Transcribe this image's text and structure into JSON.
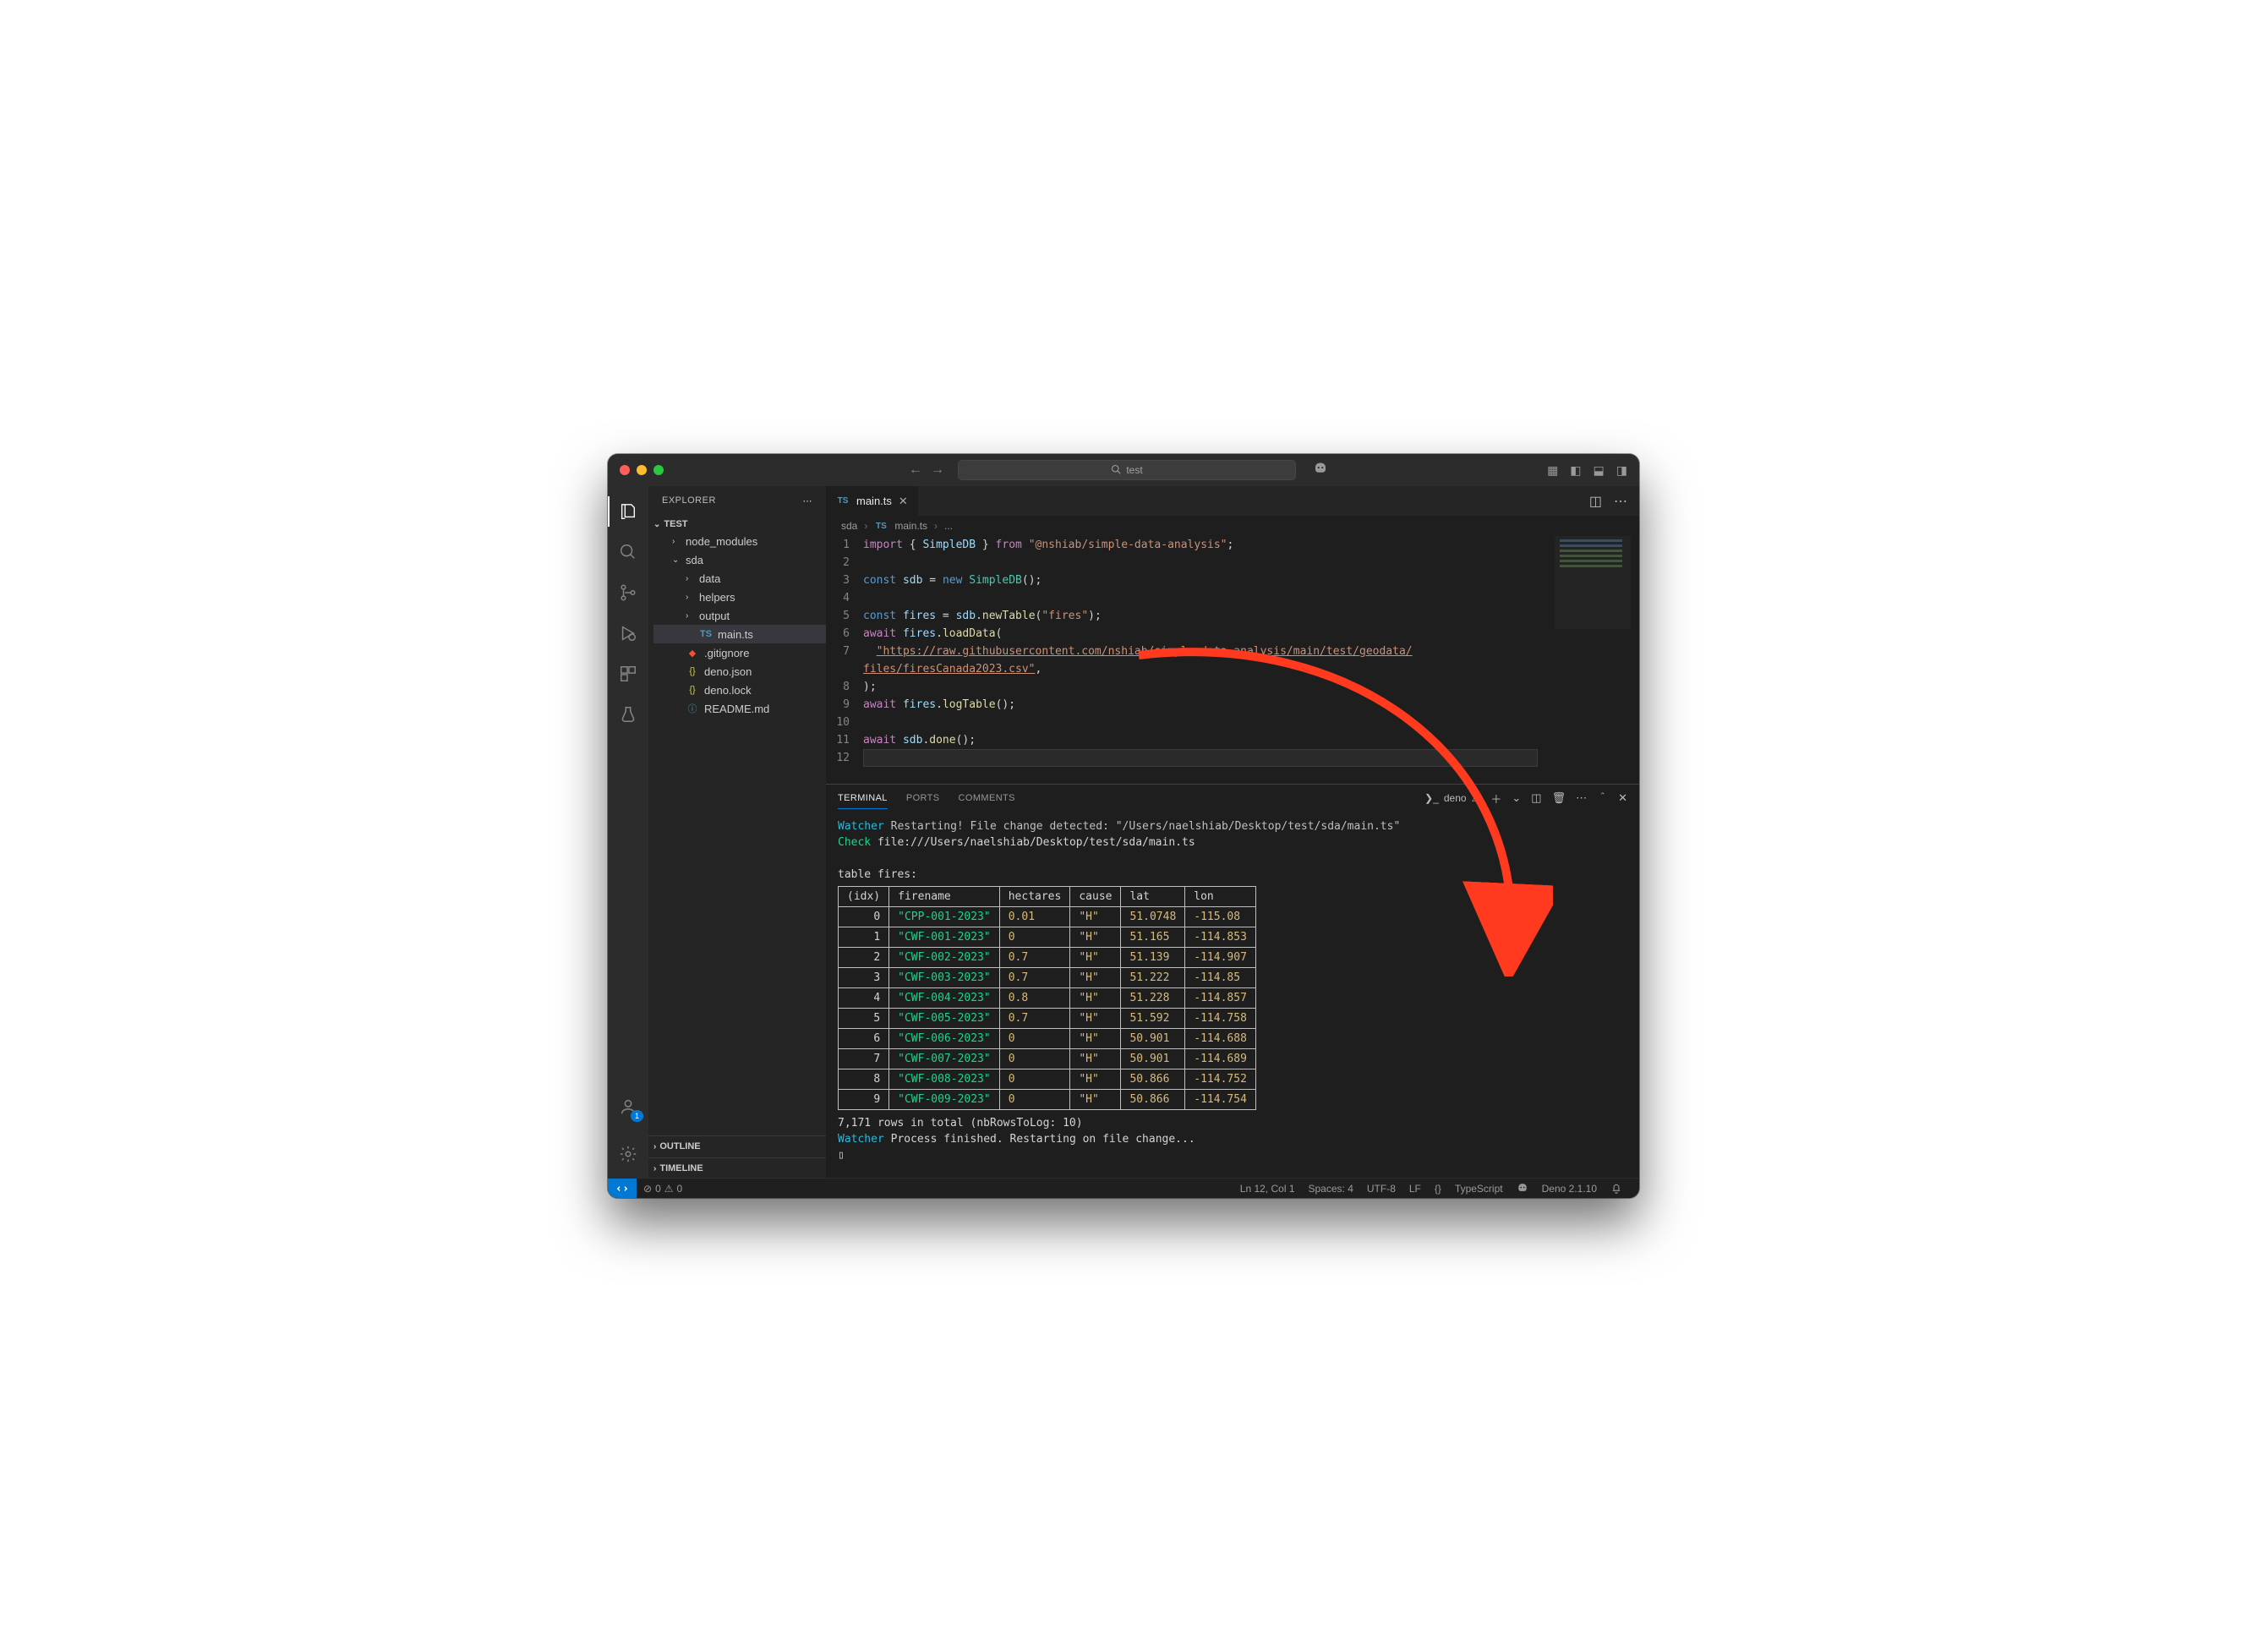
{
  "titlebar": {
    "search_text": "test"
  },
  "sidebar": {
    "title": "EXPLORER",
    "root": "TEST",
    "tree": {
      "node_modules": "node_modules",
      "sda": "sda",
      "data": "data",
      "helpers": "helpers",
      "output": "output",
      "main_ts": "main.ts",
      "gitignore": ".gitignore",
      "deno_json": "deno.json",
      "deno_lock": "deno.lock",
      "readme": "README.md"
    },
    "outline": "OUTLINE",
    "timeline": "TIMELINE"
  },
  "tab": {
    "filename": "main.ts"
  },
  "breadcrumbs": {
    "p0": "sda",
    "p1": "main.ts",
    "p2": "..."
  },
  "code": {
    "l1": {
      "a": "import",
      "b": "{ ",
      "c": "SimpleDB",
      "d": " }",
      "e": " from ",
      "f": "\"@nshiab/simple-data-analysis\"",
      "g": ";"
    },
    "l3": {
      "a": "const ",
      "b": "sdb",
      "c": " = ",
      "d": "new ",
      "e": "SimpleDB",
      "f": "();"
    },
    "l5": {
      "a": "const ",
      "b": "fires",
      "c": " = ",
      "d": "sdb",
      "e": ".",
      "f": "newTable",
      "g": "(",
      "h": "\"fires\"",
      "i": ");"
    },
    "l6": {
      "a": "await ",
      "b": "fires",
      "c": ".",
      "d": "loadData",
      "e": "("
    },
    "l7": {
      "a": "  ",
      "b": "\"https://raw.githubusercontent.com/nshiab/simple-data-analysis/main/test/geodata/"
    },
    "l7b": {
      "a": "files/firesCanada2023.csv\"",
      "b": ","
    },
    "l8": ");",
    "l9": {
      "a": "await ",
      "b": "fires",
      "c": ".",
      "d": "logTable",
      "e": "();"
    },
    "l11": {
      "a": "await ",
      "b": "sdb",
      "c": ".",
      "d": "done",
      "e": "();"
    }
  },
  "line_numbers": [
    "1",
    "2",
    "3",
    "4",
    "5",
    "6",
    "7",
    "",
    "8",
    "9",
    "10",
    "11",
    "12"
  ],
  "panel": {
    "tabs": {
      "terminal": "TERMINAL",
      "ports": "PORTS",
      "comments": "COMMENTS"
    },
    "deno": "deno"
  },
  "terminal": {
    "watcher_label": "Watcher",
    "restarting": " Restarting! File change detected: ",
    "restart_path": "\"/Users/naelshiab/Desktop/test/sda/main.ts\"",
    "check_label": "Check",
    "check_path": " file:///Users/naelshiab/Desktop/test/sda/main.ts",
    "table_label": "table fires:",
    "headers": {
      "idx": "(idx)",
      "firename": "firename",
      "hectares": "hectares",
      "cause": "cause",
      "lat": "lat",
      "lon": "lon"
    },
    "rows": [
      {
        "idx": "0",
        "firename": "\"CPP-001-2023\"",
        "hectares": "0.01",
        "cause": "\"H\"",
        "lat": "51.0748",
        "lon": "-115.08"
      },
      {
        "idx": "1",
        "firename": "\"CWF-001-2023\"",
        "hectares": "0",
        "cause": "\"H\"",
        "lat": "51.165",
        "lon": "-114.853"
      },
      {
        "idx": "2",
        "firename": "\"CWF-002-2023\"",
        "hectares": "0.7",
        "cause": "\"H\"",
        "lat": "51.139",
        "lon": "-114.907"
      },
      {
        "idx": "3",
        "firename": "\"CWF-003-2023\"",
        "hectares": "0.7",
        "cause": "\"H\"",
        "lat": "51.222",
        "lon": "-114.85"
      },
      {
        "idx": "4",
        "firename": "\"CWF-004-2023\"",
        "hectares": "0.8",
        "cause": "\"H\"",
        "lat": "51.228",
        "lon": "-114.857"
      },
      {
        "idx": "5",
        "firename": "\"CWF-005-2023\"",
        "hectares": "0.7",
        "cause": "\"H\"",
        "lat": "51.592",
        "lon": "-114.758"
      },
      {
        "idx": "6",
        "firename": "\"CWF-006-2023\"",
        "hectares": "0",
        "cause": "\"H\"",
        "lat": "50.901",
        "lon": "-114.688"
      },
      {
        "idx": "7",
        "firename": "\"CWF-007-2023\"",
        "hectares": "0",
        "cause": "\"H\"",
        "lat": "50.901",
        "lon": "-114.689"
      },
      {
        "idx": "8",
        "firename": "\"CWF-008-2023\"",
        "hectares": "0",
        "cause": "\"H\"",
        "lat": "50.866",
        "lon": "-114.752"
      },
      {
        "idx": "9",
        "firename": "\"CWF-009-2023\"",
        "hectares": "0",
        "cause": "\"H\"",
        "lat": "50.866",
        "lon": "-114.754"
      }
    ],
    "summary": "7,171 rows in total (nbRowsToLog: 10)",
    "finished": " Process finished. Restarting on file change...",
    "cursor": "▯"
  },
  "status": {
    "errors": "0",
    "warnings": "0",
    "lncol": "Ln 12, Col 1",
    "spaces": "Spaces: 4",
    "encoding": "UTF-8",
    "eol": "LF",
    "lang": "TypeScript",
    "deno": "Deno 2.1.10",
    "braces": "{}"
  }
}
